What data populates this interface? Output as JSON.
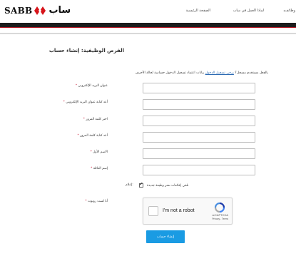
{
  "header": {
    "logo_latin": "SABB",
    "logo_arabic": "ساب",
    "nav": {
      "careers": "وظائف",
      "why_join": "لماذا العمل في ساب",
      "home": "الصفحة الرئيسية"
    }
  },
  "page": {
    "title": "الفرص الوظيفية: إنشاء حساب",
    "intro_before": "بالفعل مستخدم مسجل؟ ",
    "intro_link": "برجى تسجيل الدخول",
    "intro_after": " بيانات اعتماد تسجيل الدخول حساسة لحالة الأحرف"
  },
  "form": {
    "fields": [
      {
        "label": "عنوان البريد الإلكتروني",
        "required": "*",
        "value": ""
      },
      {
        "label": "أعد كتابة عنوان البريد الإلكتروني",
        "required": "*",
        "value": ""
      },
      {
        "label": "اختر كلمة المرور",
        "required": "*",
        "value": ""
      },
      {
        "label": "أعد كتابة كلمة المرور",
        "required": "*",
        "value": ""
      },
      {
        "label": "الاسم الأول",
        "required": "*",
        "value": ""
      },
      {
        "label": "إسم العائلة",
        "required": "*",
        "value": ""
      }
    ],
    "alerts_checkbox": {
      "label": "تلقي إعلامات نشر وظيفة جديدة",
      "side_label": "إعلام:",
      "checked": true
    },
    "robot_label": "أنا لست روبوت",
    "robot_required": "*",
    "captcha": {
      "text": "I'm not a robot",
      "brand": "reCAPTCHA",
      "terms": "Privacy - Terms"
    },
    "submit_label": "إنشاء حساب"
  },
  "colors": {
    "accent_red": "#b3121f",
    "topbar": "#1c1c1c",
    "submit": "#1a9be3",
    "required": "#c8102e"
  }
}
